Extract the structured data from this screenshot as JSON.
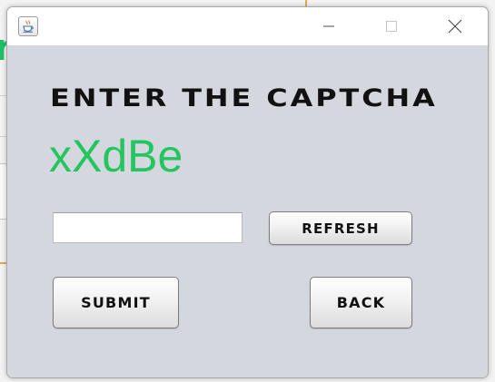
{
  "window": {
    "title": "",
    "icon": "java-cup-icon",
    "controls": {
      "minimize": "minimize-icon",
      "maximize": "maximize-icon",
      "close": "close-icon"
    }
  },
  "form": {
    "heading": "ENTER THE CAPTCHA",
    "captcha_value": "xXdBe",
    "captcha_color": "#22c55e",
    "input_value": "",
    "input_placeholder": "",
    "refresh_label": "REFRESH",
    "submit_label": "SUBMIT",
    "back_label": "BACK"
  },
  "background_app": {
    "accent_color": "#1fbf6a",
    "line_color": "#e9a64a"
  }
}
